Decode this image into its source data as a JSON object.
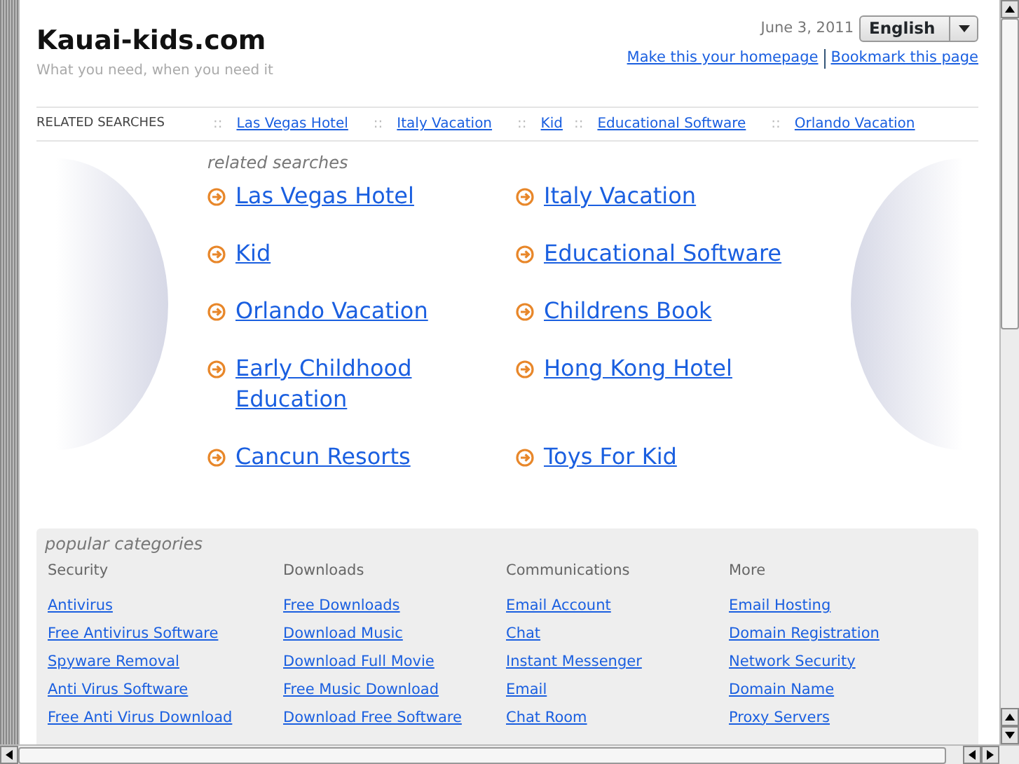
{
  "header": {
    "site_title": "Kauai-kids.com",
    "tagline": "What you need, when you need it",
    "date": "June 3, 2011",
    "language_select": {
      "value": "English"
    },
    "links": [
      "Make this your homepage",
      "Bookmark this page"
    ]
  },
  "related_bar": {
    "label": "RELATED SEARCHES",
    "separator": "::",
    "links": [
      "Las Vegas Hotel",
      "Italy Vacation",
      "Kid",
      "Educational Software",
      "Orlando Vacation"
    ]
  },
  "related_searches": {
    "heading": "related searches",
    "links": [
      "Las Vegas Hotel",
      "Italy Vacation",
      "Kid",
      "Educational Software",
      "Orlando Vacation",
      "Childrens Book",
      "Early Childhood Education",
      "Hong Kong Hotel",
      "Cancun Resorts",
      "Toys For Kid"
    ]
  },
  "popular_categories": {
    "heading": "popular categories",
    "columns": [
      {
        "title": "Security",
        "links": [
          "Antivirus",
          "Free Antivirus Software",
          "Spyware Removal",
          "Anti Virus Software",
          "Free Anti Virus Download"
        ]
      },
      {
        "title": "Downloads",
        "links": [
          "Free Downloads",
          "Download Music",
          "Download Full Movie",
          "Free Music Download",
          "Download Free Software"
        ]
      },
      {
        "title": "Communications",
        "links": [
          "Email Account",
          "Chat",
          "Instant Messenger",
          "Email",
          "Chat Room"
        ]
      },
      {
        "title": "More",
        "links": [
          "Email Hosting",
          "Domain Registration",
          "Network Security",
          "Domain Name",
          "Proxy Servers"
        ]
      }
    ]
  }
}
